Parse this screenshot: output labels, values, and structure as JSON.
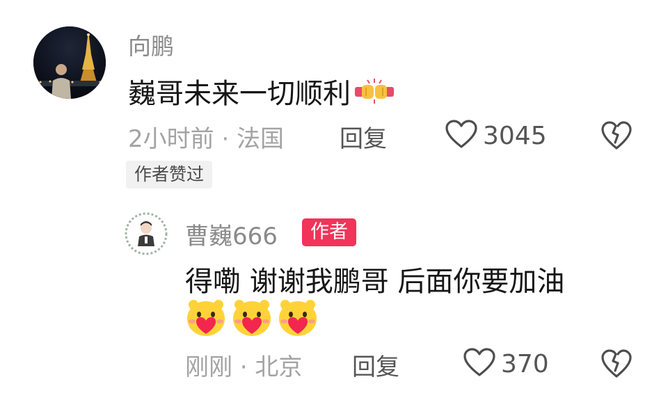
{
  "comment": {
    "username": "向鹏",
    "text": "巍哥未来一切顺利",
    "time_location": "2小时前 · 法国",
    "reply_label": "回复",
    "like_count": "3045",
    "author_liked_badge": "作者赞过",
    "emoji_icon": "fist-bump-emoji"
  },
  "reply": {
    "username": "曹巍666",
    "author_tag": "作者",
    "text": "得嘞 谢谢我鹏哥 后面你要加油",
    "emoji_icons": [
      "heart-face-emoji",
      "heart-face-emoji",
      "heart-face-emoji"
    ],
    "time_location": "刚刚 · 北京",
    "reply_label": "回复",
    "like_count": "370"
  },
  "colors": {
    "author_tag_bg": "#f2335a",
    "meta_gray": "#a3a3a3",
    "username_gray": "#8a8a8a",
    "badge_bg": "#f1f1f1"
  }
}
